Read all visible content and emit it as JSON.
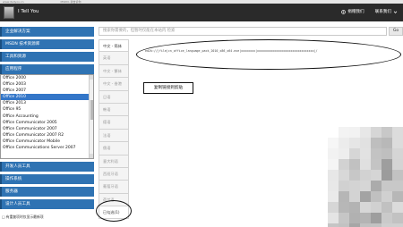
{
  "browser": {
    "url": "www.itellyou.cn",
    "tab_title": "MSDN, 我告诉你"
  },
  "header": {
    "brand": "I Tell You",
    "links": [
      {
        "label": "捐赠我们",
        "icon": "donate-icon"
      },
      {
        "label": "联系我们",
        "icon": "chevron-down-icon"
      }
    ]
  },
  "sidebar": {
    "top_items": [
      {
        "label": "企业解决方案"
      },
      {
        "label": "MSDN 技术资源库"
      },
      {
        "label": "工具和资源"
      },
      {
        "label": "应用程序"
      }
    ],
    "options": [
      "Office 2000",
      "Office 2003",
      "Office 2007",
      "Office 2010",
      "Office 2013",
      "Office 95",
      "Office Accounting",
      "Office Communicator 2005",
      "Office Communicator 2007",
      "Office Communicator 2007 R2",
      "Office Communicator Mobile",
      "Office Communications Server 2007"
    ],
    "selected_option": "Office 2010",
    "bottom_items": [
      {
        "label": "开发人员工具"
      },
      {
        "label": "操作系统"
      },
      {
        "label": "服务器"
      },
      {
        "label": "设计人员工具"
      }
    ],
    "footnote": "□ 有重复项时仅显示最新项"
  },
  "main": {
    "search_placeholder": "搜索你需要的，但暂时仅能在本站内 检索",
    "go_label": "Go",
    "tabs": [
      {
        "label": "中文 - 简体",
        "active": true
      },
      {
        "label": "英语"
      },
      {
        "label": "中文 - 繁体"
      },
      {
        "label": "中文 - 香港"
      },
      {
        "label": "日语"
      },
      {
        "label": "韩语"
      },
      {
        "label": "德语"
      },
      {
        "label": "法语"
      },
      {
        "label": "俄语"
      },
      {
        "label": "意大利语"
      },
      {
        "label": "西班牙语"
      },
      {
        "label": "葡萄牙语"
      },
      {
        "label": "荷兰语"
      },
      {
        "label": "已勾选(1)",
        "active": true
      }
    ],
    "ed2k_link": "ed2k://|file|cn_office_language_pack_2010_x86_x64.exe|xxxxxxxx|xxxxxxxxxxxxxxxxxxxxxxxxxxxxxxxx|/",
    "copy_button_label": "复制链接到剪贴"
  }
}
